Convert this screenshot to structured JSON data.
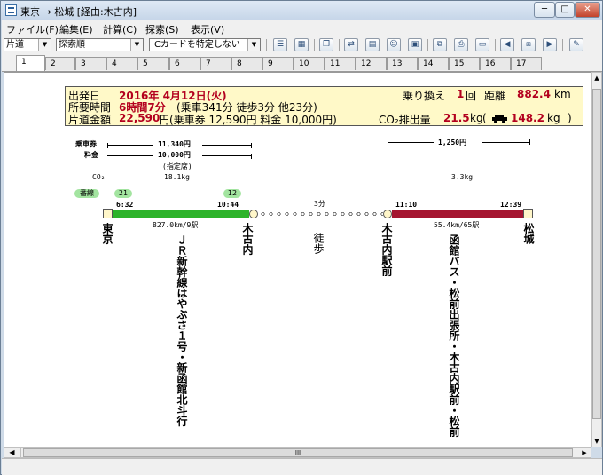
{
  "window": {
    "title": "東京 → 松城 [経由:木古内]",
    "buttons": {
      "minimize": "─",
      "maximize": "□",
      "close": "✕"
    }
  },
  "menu": [
    "ファイル(F)",
    "編集(E)",
    "計算(C)",
    "探索(S)",
    "表示(V)"
  ],
  "toolbar": {
    "mode_select": "片道",
    "sort_select": "探索順",
    "ic_select": "ICカードを特定しない"
  },
  "tabs": [
    "1",
    "2",
    "3",
    "4",
    "5",
    "6",
    "7",
    "8",
    "9",
    "10",
    "11",
    "12",
    "13",
    "14",
    "15",
    "16",
    "17"
  ],
  "summary": {
    "depart_label": "出発日",
    "depart_date": "2016年 4月12日(火)",
    "time_label": "所要時間",
    "time_main": "6時間7分",
    "time_detail": "(乗車341分 徒歩3分 他23分)",
    "fare_label": "片道金額",
    "fare_total": "22,590",
    "fare_detail": "円(乗車券 12,590円 料金 10,000円)",
    "transfer_label": "乗り換え",
    "transfer_count": "1",
    "transfer_unit": "回",
    "distance_label": "距離",
    "distance_value": "882.4",
    "distance_unit": "km",
    "co2_label": "CO₂排出量",
    "co2_value": "21.5",
    "co2_unit": "kg",
    "co2_car_value": "148.2",
    "co2_car_unit": "kg"
  },
  "legend": {
    "ticket_label": "乗車券",
    "fee_label": "料金",
    "co2_label": "CO₂",
    "line_label": "番線"
  },
  "segment1": {
    "ticket": "11,340円",
    "fee": "10,000円",
    "fee_note": "(指定席)",
    "co2": "18.1kg",
    "platform_from": "21",
    "platform_to": "12",
    "dep_time": "6:32",
    "arr_time": "10:44",
    "distance": "827.0km/9駅",
    "train": "ＪＲ新幹線はやぶさ１号・新函館北斗行",
    "color": "#2db32a"
  },
  "walk": {
    "duration": "3分",
    "label": "徒歩"
  },
  "segment2": {
    "ticket": "1,250円",
    "co2": "3.3kg",
    "dep_time": "11:10",
    "arr_time": "12:39",
    "distance": "55.4km/65駅",
    "train": "函館バス・松前出張所・木古内駅前・松前",
    "color": "#a51530"
  },
  "stations": {
    "origin": "東京",
    "transfer1": "木古内",
    "transfer2": "木古内駅前",
    "destination": "松城"
  },
  "scrollbar": {
    "hscroll_marker": "III"
  }
}
